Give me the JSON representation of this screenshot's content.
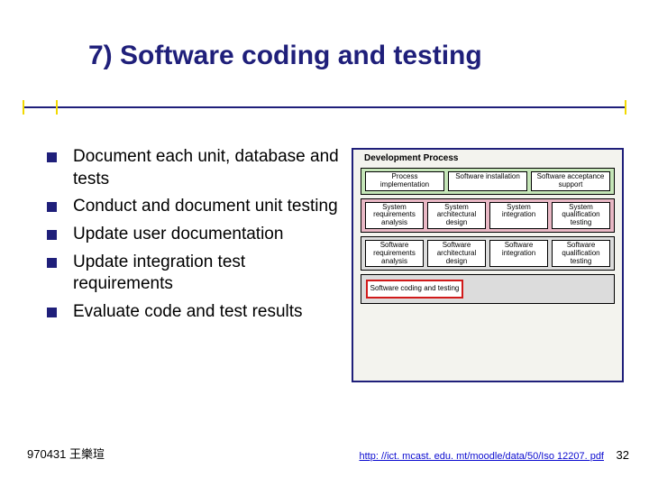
{
  "title": "7) Software coding and testing",
  "bullets": [
    "Document each unit, database and tests",
    "Conduct and document unit testing",
    "Update user documentation",
    "Update integration test requirements",
    "Evaluate code and test results"
  ],
  "diagram": {
    "heading": "Development Process",
    "row1": [
      "Process implementation",
      "Software installation",
      "Software acceptance support"
    ],
    "row2": [
      "System requirements analysis",
      "System architectural design",
      "System integration",
      "System qualification testing"
    ],
    "row3": [
      "Software requirements analysis",
      "Software architectural design",
      "Software integration",
      "Software qualification testing"
    ],
    "highlight": "Software coding and testing"
  },
  "footer_left": "970431 王樂瑄",
  "footer_link_text": "http: //ict. mcast. edu. mt/moodle/data/50/Iso 12207. pdf",
  "footer_link_href": "http://ict.mcast.edu.mt/moodle/data/50/Iso12207.pdf",
  "page_number": "32"
}
